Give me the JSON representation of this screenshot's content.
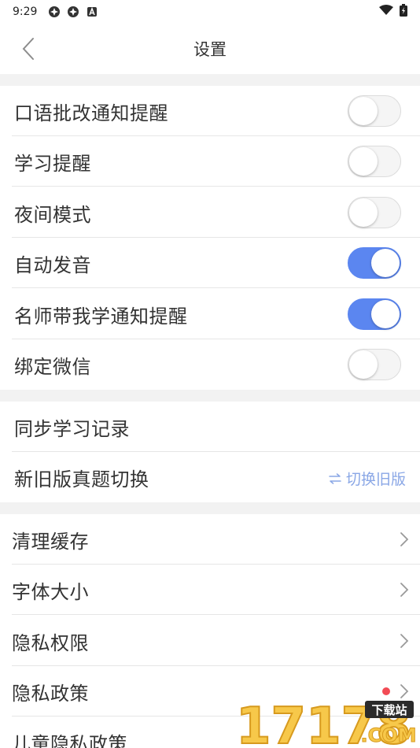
{
  "status": {
    "time": "9:29"
  },
  "nav": {
    "title": "设置"
  },
  "toggles": [
    {
      "label": "口语批改通知提醒",
      "on": false
    },
    {
      "label": "学习提醒",
      "on": false
    },
    {
      "label": "夜间模式",
      "on": false
    },
    {
      "label": "自动发音",
      "on": true
    },
    {
      "label": "名师带我学通知提醒",
      "on": true
    },
    {
      "label": "绑定微信",
      "on": false
    }
  ],
  "sync": {
    "label": "同步学习记录"
  },
  "version": {
    "label": "新旧版真题切换",
    "action": "切换旧版"
  },
  "links": [
    {
      "label": "清理缓存"
    },
    {
      "label": "字体大小"
    },
    {
      "label": "隐私权限"
    },
    {
      "label": "隐私政策",
      "badge": true
    },
    {
      "label": "儿童隐私政策"
    }
  ],
  "watermark": {
    "text": "17178",
    "badge": "下载站",
    "domain": ".COM"
  },
  "colors": {
    "toggle_on": "#5b86f0",
    "link_blue": "#8aa7e6",
    "badge_red": "#f24b55",
    "section_gap": "#f2f2f2"
  }
}
